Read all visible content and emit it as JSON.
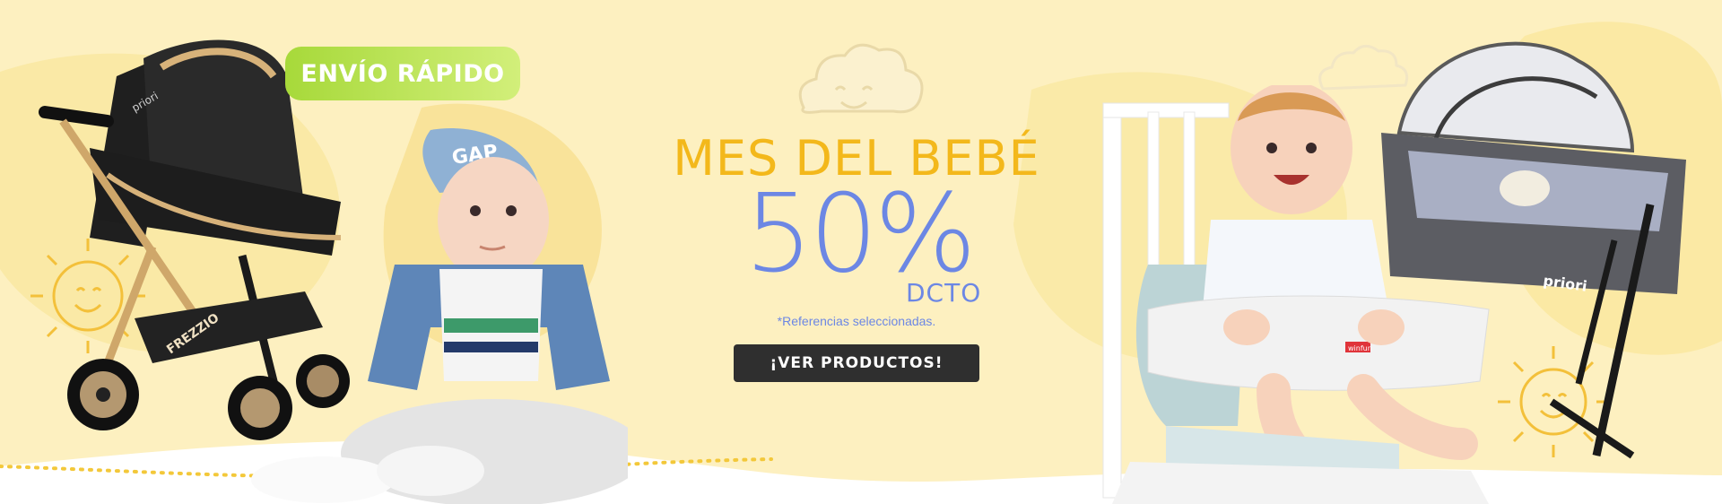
{
  "badge": {
    "label": "ENVÍO RÁPIDO"
  },
  "promo": {
    "headline": "MES DEL BEBÉ",
    "percent": "50%",
    "discount_label": "DCTO",
    "note": "*Referencias seleccionadas.",
    "cta_label": "¡VER PRODUCTOS!"
  },
  "stroller": {
    "brand": "priori",
    "model": "FREZZIO"
  },
  "baby_cap": {
    "text": "GAP"
  },
  "bassinet": {
    "brand": "priori"
  },
  "highchair": {
    "brand": "winfun"
  },
  "colors": {
    "background": "#fdf0c0",
    "headline": "#f3b81b",
    "accent": "#6c87e4",
    "badge": "#a7d93a",
    "cta": "#2f2f2f"
  }
}
